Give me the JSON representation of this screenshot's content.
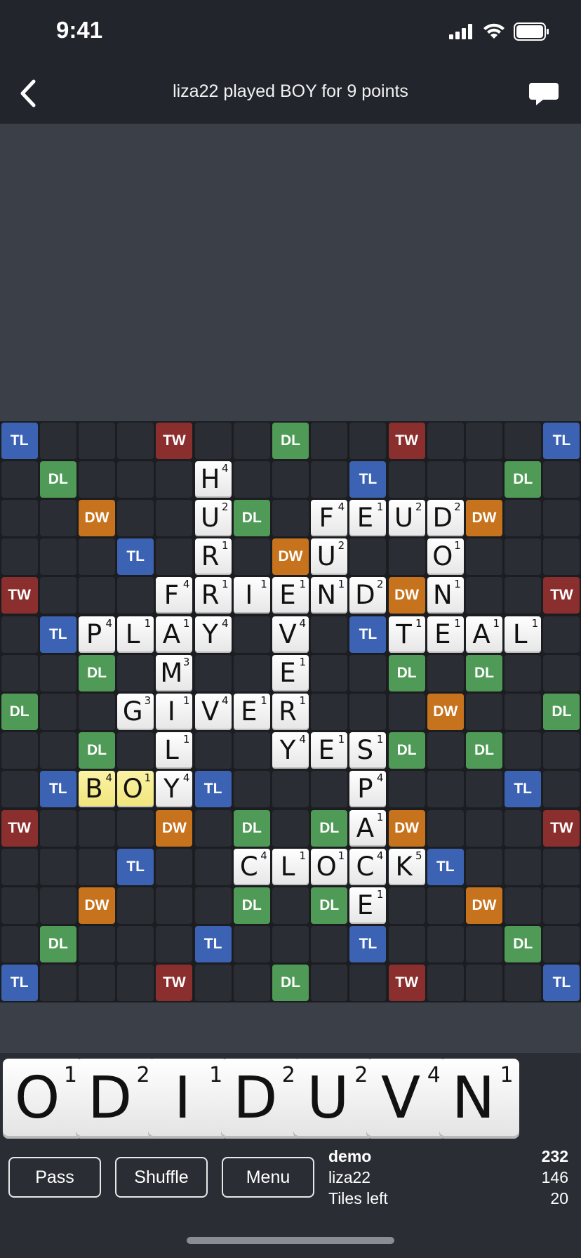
{
  "status": {
    "time": "9:41"
  },
  "nav": {
    "title": "liza22 played BOY for 9 points"
  },
  "board": {
    "bonus_squares": [
      {
        "r": 0,
        "c": 0,
        "t": "TL"
      },
      {
        "r": 0,
        "c": 4,
        "t": "TW"
      },
      {
        "r": 0,
        "c": 7,
        "t": "DL"
      },
      {
        "r": 0,
        "c": 10,
        "t": "TW"
      },
      {
        "r": 0,
        "c": 14,
        "t": "TL"
      },
      {
        "r": 1,
        "c": 1,
        "t": "DL"
      },
      {
        "r": 1,
        "c": 9,
        "t": "TL"
      },
      {
        "r": 1,
        "c": 13,
        "t": "DL"
      },
      {
        "r": 2,
        "c": 2,
        "t": "DW"
      },
      {
        "r": 2,
        "c": 6,
        "t": "DL"
      },
      {
        "r": 2,
        "c": 12,
        "t": "DW"
      },
      {
        "r": 3,
        "c": 3,
        "t": "TL"
      },
      {
        "r": 3,
        "c": 7,
        "t": "DW"
      },
      {
        "r": 4,
        "c": 0,
        "t": "TW"
      },
      {
        "r": 4,
        "c": 10,
        "t": "DW"
      },
      {
        "r": 4,
        "c": 14,
        "t": "TW"
      },
      {
        "r": 5,
        "c": 1,
        "t": "TL"
      },
      {
        "r": 5,
        "c": 9,
        "t": "TL"
      },
      {
        "r": 6,
        "c": 2,
        "t": "DL"
      },
      {
        "r": 6,
        "c": 10,
        "t": "DL"
      },
      {
        "r": 6,
        "c": 12,
        "t": "DL"
      },
      {
        "r": 7,
        "c": 0,
        "t": "DL"
      },
      {
        "r": 7,
        "c": 11,
        "t": "DW"
      },
      {
        "r": 7,
        "c": 14,
        "t": "DL"
      },
      {
        "r": 8,
        "c": 2,
        "t": "DL"
      },
      {
        "r": 8,
        "c": 10,
        "t": "DL"
      },
      {
        "r": 8,
        "c": 12,
        "t": "DL"
      },
      {
        "r": 9,
        "c": 1,
        "t": "TL"
      },
      {
        "r": 9,
        "c": 5,
        "t": "TL"
      },
      {
        "r": 9,
        "c": 13,
        "t": "TL"
      },
      {
        "r": 10,
        "c": 0,
        "t": "TW"
      },
      {
        "r": 10,
        "c": 4,
        "t": "DW"
      },
      {
        "r": 10,
        "c": 6,
        "t": "DL"
      },
      {
        "r": 10,
        "c": 8,
        "t": "DL"
      },
      {
        "r": 10,
        "c": 10,
        "t": "DW"
      },
      {
        "r": 10,
        "c": 14,
        "t": "TW"
      },
      {
        "r": 11,
        "c": 3,
        "t": "TL"
      },
      {
        "r": 11,
        "c": 11,
        "t": "TL"
      },
      {
        "r": 12,
        "c": 2,
        "t": "DW"
      },
      {
        "r": 12,
        "c": 6,
        "t": "DL"
      },
      {
        "r": 12,
        "c": 8,
        "t": "DL"
      },
      {
        "r": 12,
        "c": 12,
        "t": "DW"
      },
      {
        "r": 13,
        "c": 1,
        "t": "DL"
      },
      {
        "r": 13,
        "c": 5,
        "t": "TL"
      },
      {
        "r": 13,
        "c": 9,
        "t": "TL"
      },
      {
        "r": 13,
        "c": 13,
        "t": "DL"
      },
      {
        "r": 14,
        "c": 0,
        "t": "TL"
      },
      {
        "r": 14,
        "c": 4,
        "t": "TW"
      },
      {
        "r": 14,
        "c": 7,
        "t": "DL"
      },
      {
        "r": 14,
        "c": 10,
        "t": "TW"
      },
      {
        "r": 14,
        "c": 14,
        "t": "TL"
      }
    ],
    "tiles": [
      {
        "r": 1,
        "c": 5,
        "l": "H",
        "p": "4"
      },
      {
        "r": 2,
        "c": 5,
        "l": "U",
        "p": "2"
      },
      {
        "r": 2,
        "c": 8,
        "l": "F",
        "p": "4"
      },
      {
        "r": 2,
        "c": 9,
        "l": "E",
        "p": "1"
      },
      {
        "r": 2,
        "c": 10,
        "l": "U",
        "p": "2"
      },
      {
        "r": 2,
        "c": 11,
        "l": "D",
        "p": "2"
      },
      {
        "r": 3,
        "c": 5,
        "l": "R",
        "p": "1"
      },
      {
        "r": 3,
        "c": 8,
        "l": "U",
        "p": "2"
      },
      {
        "r": 3,
        "c": 11,
        "l": "O",
        "p": "1"
      },
      {
        "r": 4,
        "c": 4,
        "l": "F",
        "p": "4"
      },
      {
        "r": 4,
        "c": 5,
        "l": "R",
        "p": "1"
      },
      {
        "r": 4,
        "c": 6,
        "l": "I",
        "p": "1"
      },
      {
        "r": 4,
        "c": 7,
        "l": "E",
        "p": "1"
      },
      {
        "r": 4,
        "c": 8,
        "l": "N",
        "p": "1"
      },
      {
        "r": 4,
        "c": 9,
        "l": "D",
        "p": "2"
      },
      {
        "r": 4,
        "c": 11,
        "l": "N",
        "p": "1"
      },
      {
        "r": 5,
        "c": 2,
        "l": "P",
        "p": "4"
      },
      {
        "r": 5,
        "c": 3,
        "l": "L",
        "p": "1"
      },
      {
        "r": 5,
        "c": 4,
        "l": "A",
        "p": "1"
      },
      {
        "r": 5,
        "c": 5,
        "l": "Y",
        "p": "4"
      },
      {
        "r": 5,
        "c": 7,
        "l": "V",
        "p": "4"
      },
      {
        "r": 5,
        "c": 10,
        "l": "T",
        "p": "1"
      },
      {
        "r": 5,
        "c": 11,
        "l": "E",
        "p": "1"
      },
      {
        "r": 5,
        "c": 12,
        "l": "A",
        "p": "1"
      },
      {
        "r": 5,
        "c": 13,
        "l": "L",
        "p": "1"
      },
      {
        "r": 6,
        "c": 4,
        "l": "M",
        "p": "3"
      },
      {
        "r": 6,
        "c": 7,
        "l": "E",
        "p": "1"
      },
      {
        "r": 7,
        "c": 3,
        "l": "G",
        "p": "3"
      },
      {
        "r": 7,
        "c": 4,
        "l": "I",
        "p": "1"
      },
      {
        "r": 7,
        "c": 5,
        "l": "V",
        "p": "4"
      },
      {
        "r": 7,
        "c": 6,
        "l": "E",
        "p": "1"
      },
      {
        "r": 7,
        "c": 7,
        "l": "R",
        "p": "1"
      },
      {
        "r": 8,
        "c": 4,
        "l": "L",
        "p": "1"
      },
      {
        "r": 8,
        "c": 7,
        "l": "Y",
        "p": "4"
      },
      {
        "r": 8,
        "c": 8,
        "l": "E",
        "p": "1"
      },
      {
        "r": 8,
        "c": 9,
        "l": "S",
        "p": "1"
      },
      {
        "r": 9,
        "c": 2,
        "l": "B",
        "p": "4",
        "new": true
      },
      {
        "r": 9,
        "c": 3,
        "l": "O",
        "p": "1",
        "new": true
      },
      {
        "r": 9,
        "c": 4,
        "l": "Y",
        "p": "4"
      },
      {
        "r": 9,
        "c": 9,
        "l": "P",
        "p": "4"
      },
      {
        "r": 10,
        "c": 9,
        "l": "A",
        "p": "1"
      },
      {
        "r": 11,
        "c": 6,
        "l": "C",
        "p": "4"
      },
      {
        "r": 11,
        "c": 7,
        "l": "L",
        "p": "1"
      },
      {
        "r": 11,
        "c": 8,
        "l": "O",
        "p": "1"
      },
      {
        "r": 11,
        "c": 9,
        "l": "C",
        "p": "4"
      },
      {
        "r": 11,
        "c": 10,
        "l": "K",
        "p": "5"
      },
      {
        "r": 12,
        "c": 9,
        "l": "E",
        "p": "1"
      }
    ]
  },
  "rack": [
    {
      "l": "O",
      "p": "1"
    },
    {
      "l": "D",
      "p": "2"
    },
    {
      "l": "I",
      "p": "1"
    },
    {
      "l": "D",
      "p": "2"
    },
    {
      "l": "U",
      "p": "2"
    },
    {
      "l": "V",
      "p": "4"
    },
    {
      "l": "N",
      "p": "1"
    }
  ],
  "actions": {
    "pass": "Pass",
    "shuffle": "Shuffle",
    "menu": "Menu"
  },
  "scores": [
    {
      "name": "demo",
      "value": "232"
    },
    {
      "name": "liza22",
      "value": "146"
    },
    {
      "name": "Tiles left",
      "value": "20"
    }
  ]
}
